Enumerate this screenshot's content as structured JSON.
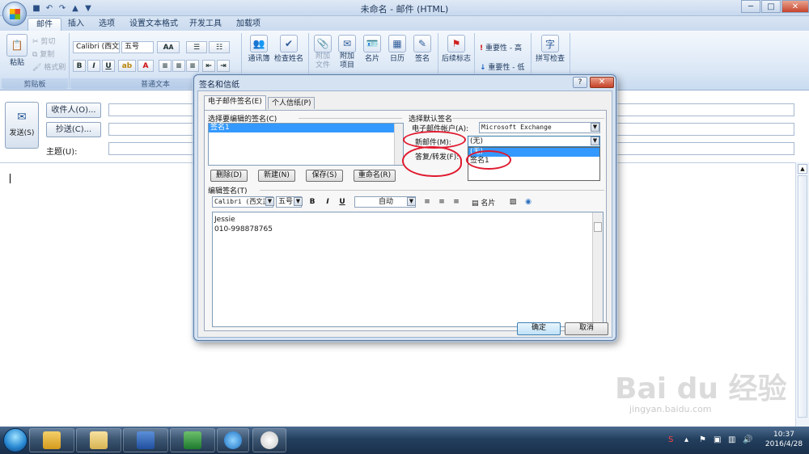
{
  "window": {
    "title": "未命名 - 邮件 (HTML)",
    "minimize": "─",
    "maximize": "□",
    "close": "✕"
  },
  "qat": [
    "save-icon",
    "undo-icon",
    "redo-icon",
    "up-icon",
    "down-icon"
  ],
  "tabs": [
    {
      "label": "邮件",
      "active": true
    },
    {
      "label": "插入",
      "active": false
    },
    {
      "label": "选项",
      "active": false
    },
    {
      "label": "设置文本格式",
      "active": false
    },
    {
      "label": "开发工具",
      "active": false
    },
    {
      "label": "加载项",
      "active": false
    }
  ],
  "ribbon": {
    "clipboard": {
      "label": "剪贴板",
      "paste": "粘贴",
      "cut": "剪切",
      "copy": "复制",
      "format_painter": "格式刷"
    },
    "basic_text": {
      "label": "普通文本",
      "font": "Calibri (西文",
      "size": "五号",
      "bold": "B",
      "italic": "I",
      "underline": "U",
      "font_color": "A"
    },
    "names": {
      "address_book": "通讯簿",
      "check_names": "检查姓名"
    },
    "include": {
      "attach_file": "附加\n文件",
      "attach_item": "附加\n项目",
      "business_card": "名片",
      "calendar": "日历",
      "signature": "签名"
    },
    "follow_up": {
      "flag": "后续标志"
    },
    "options": {
      "high": "重要性 - 高",
      "low": "重要性 - 低"
    },
    "proofing": {
      "spelling": "拼写检查"
    }
  },
  "header": {
    "send": "发送(S)",
    "to_button": "收件人(O)...",
    "cc_button": "抄送(C)...",
    "subject_label": "主题(U):"
  },
  "dialog": {
    "title": "签名和信纸",
    "help": "?",
    "close": "✕",
    "tabs": [
      {
        "label": "电子邮件签名(E)",
        "active": true
      },
      {
        "label": "个人信纸(P)",
        "active": false
      }
    ],
    "select_label": "选择要编辑的签名(C)",
    "signatures": [
      "签名1"
    ],
    "buttons": {
      "delete": "删除(D)",
      "new": "新建(N)",
      "save": "保存(S)",
      "rename": "重命名(R)"
    },
    "defaults_label": "选择默认签名",
    "account_label": "电子邮件帐户(A):",
    "account_value": "Microsoft Exchange",
    "new_messages_label": "新邮件(M):",
    "new_messages_value": "(无)",
    "reply_label": "答复/转发(F):",
    "dropdown_options": [
      "(无)",
      "签名1"
    ],
    "edit_label": "编辑签名(T)",
    "edit_font": "Calibri (西文正",
    "edit_size": "五号",
    "edit_bold": "B",
    "edit_italic": "I",
    "edit_underline": "U",
    "edit_color": "自动",
    "business_card": "名片",
    "signature_lines": [
      "Jessie",
      "010-998878765"
    ],
    "ok": "确定",
    "cancel": "取消"
  },
  "taskbar": {
    "time": "10:37",
    "date": "2016/4/28"
  },
  "watermark": {
    "brand": "Bai du 经验",
    "url": "jingyan.baidu.com"
  },
  "colors": {
    "accent": "#3399ff",
    "annotation": "#e0192e",
    "ribbon": "#dce8f6"
  }
}
